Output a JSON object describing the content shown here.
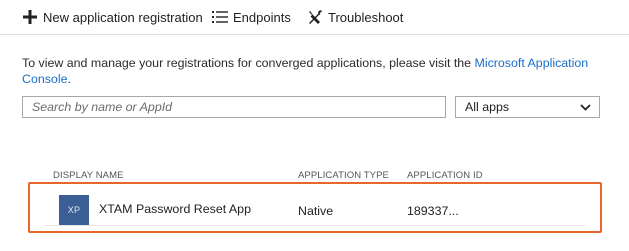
{
  "toolbar": {
    "new_label": "New application registration",
    "new_icon": "plus-icon",
    "endpoints_label": "Endpoints",
    "endpoints_icon": "list-icon",
    "troubleshoot_label": "Troubleshoot",
    "troubleshoot_icon": "wrench-screwdriver-icon"
  },
  "info": {
    "text": "To view and manage your registrations for converged applications, please visit the ",
    "link_label": "Microsoft Application Console",
    "suffix": "."
  },
  "search": {
    "placeholder": "Search by name or AppId",
    "value": ""
  },
  "filter": {
    "selected": "All apps"
  },
  "table": {
    "columns": [
      "DISPLAY NAME",
      "APPLICATION TYPE",
      "APPLICATION ID"
    ],
    "rows": [
      {
        "avatar": "XP",
        "name": "XTAM Password Reset App",
        "type": "Native",
        "id": "189337..."
      }
    ]
  },
  "colors": {
    "highlight": "#e8652d",
    "link": "#1a6fc9",
    "avatar_bg": "#3b5f95"
  }
}
